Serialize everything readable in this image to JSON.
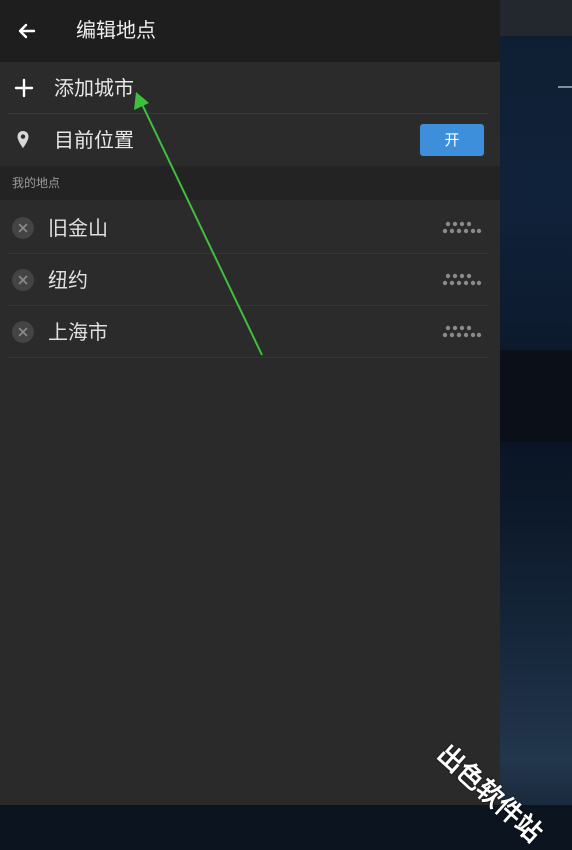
{
  "header": {
    "title": "编辑地点",
    "back_icon": "arrow-left-icon"
  },
  "add_city": {
    "label": "添加城市",
    "icon": "plus-icon"
  },
  "current_location": {
    "label": "目前位置",
    "icon": "location-pin-icon",
    "toggle_label": "开",
    "toggle_on": true,
    "accent": "#3d8fdb"
  },
  "my_places": {
    "section_label": "我的地点",
    "items": [
      {
        "name": "旧金山"
      },
      {
        "name": "纽约"
      },
      {
        "name": "上海市"
      }
    ]
  },
  "watermark": "出色软件站",
  "annotation_color": "#3fbf3f"
}
